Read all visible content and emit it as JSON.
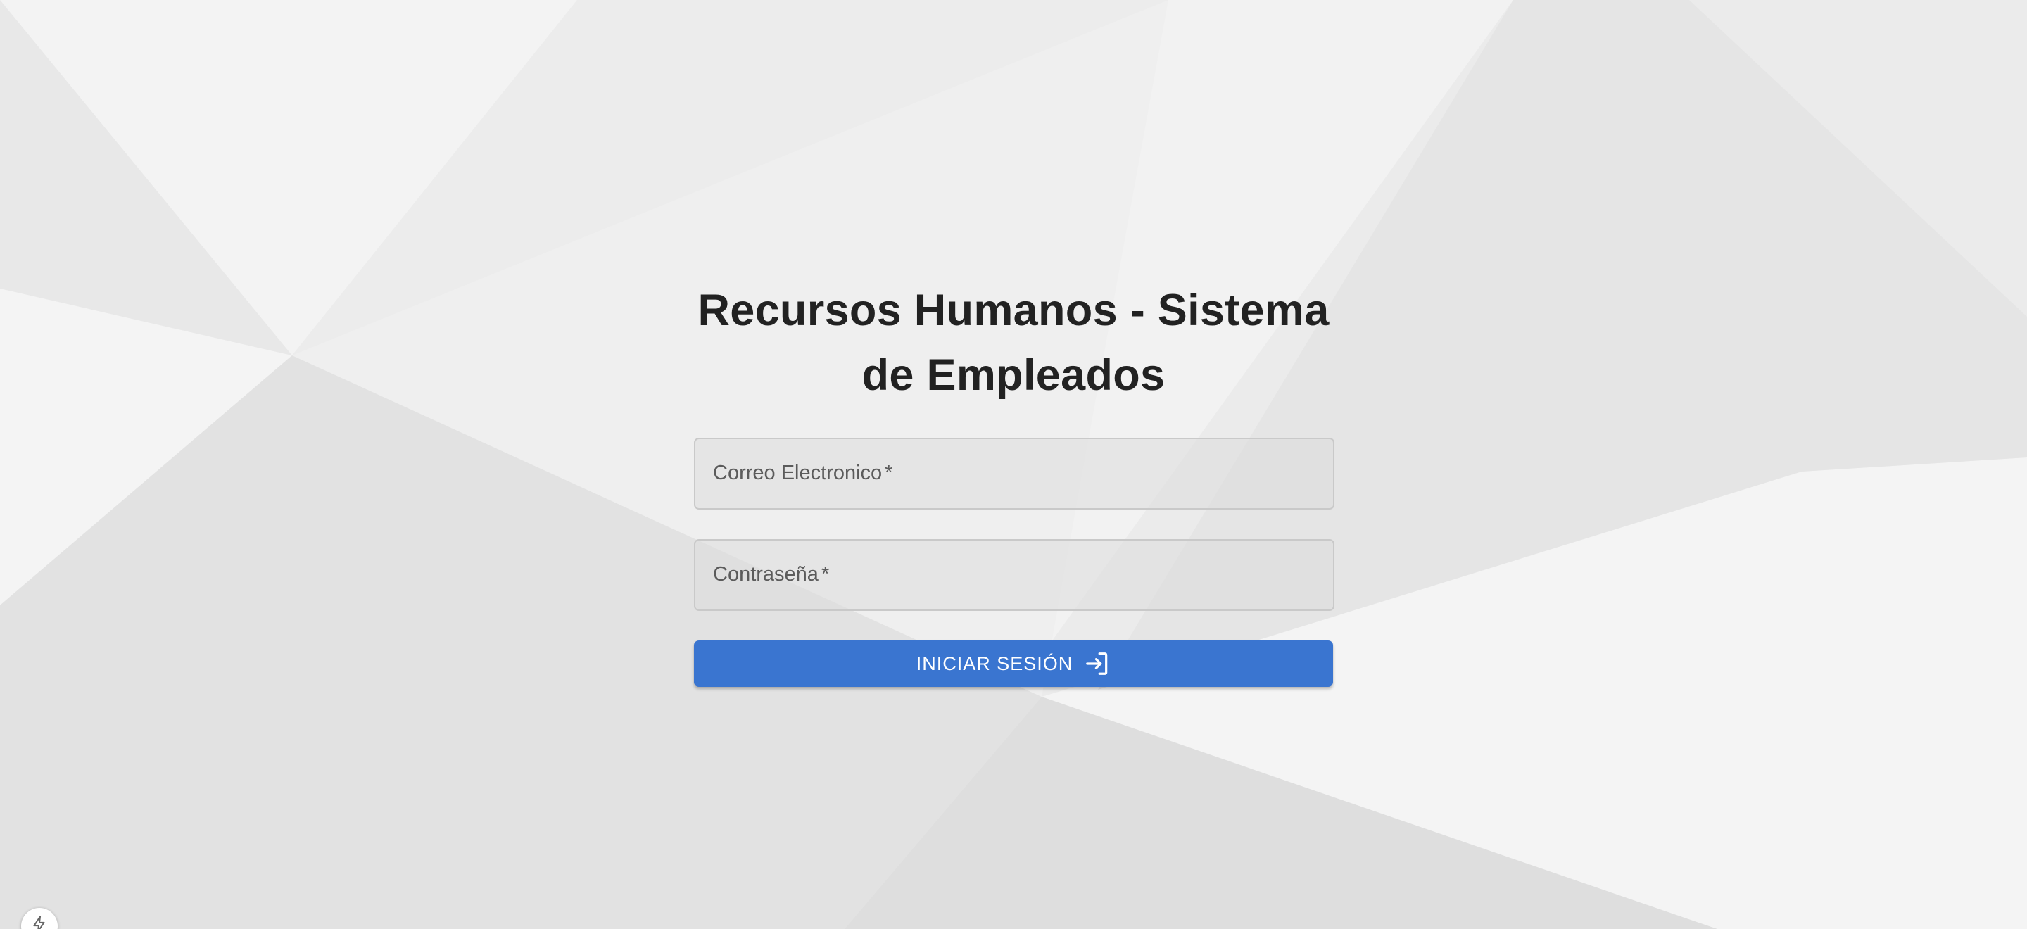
{
  "login": {
    "title": "Recursos Humanos - Sistema de Empleados",
    "email_label": "Correo Electronico",
    "password_label": "Contraseña",
    "required_mark": "*",
    "submit_label": "INICIAR SESIÓN",
    "submit_icon": "login-icon"
  },
  "floating_button": {
    "icon": "bolt-icon"
  },
  "colors": {
    "accent": "#3a75d0",
    "title": "#222222",
    "background": "#ececec"
  }
}
